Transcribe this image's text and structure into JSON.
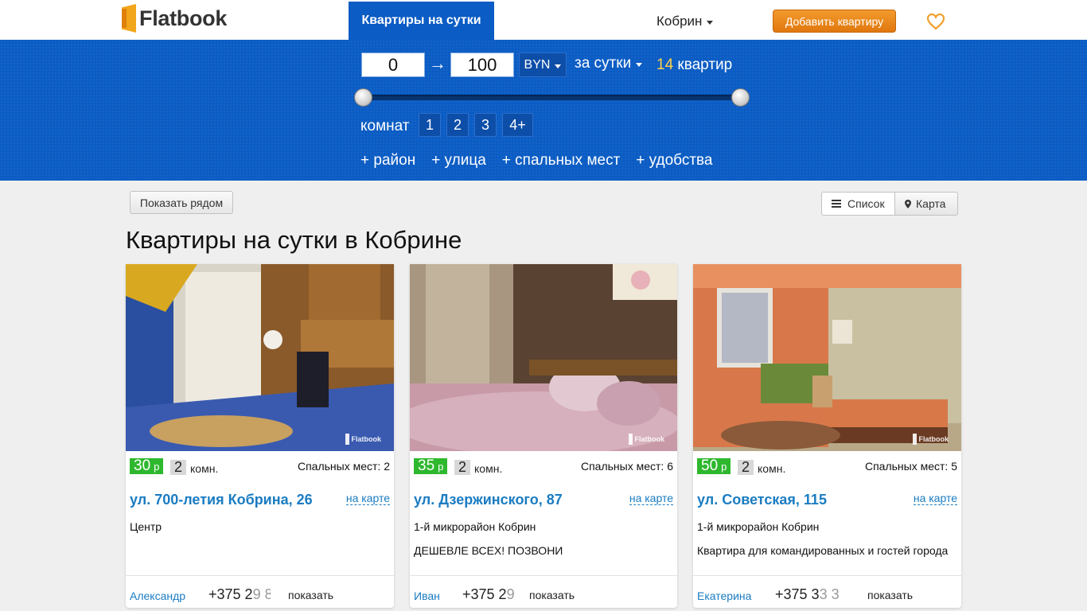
{
  "header": {
    "logo_text": "Flatbook",
    "nav_tab": "Квартиры на сутки",
    "city": "Кобрин",
    "add_button": "Добавить квартиру",
    "colors": {
      "brand_blue": "#0b5cc4",
      "accent_orange": "#e88a1f"
    }
  },
  "filters": {
    "price_min": "0",
    "arrow": "→",
    "price_max": "100",
    "currency": "BYN",
    "period": "за сутки",
    "count_number": "14",
    "count_label": "квартир",
    "rooms_label": "комнат",
    "room_options": [
      "1",
      "2",
      "3",
      "4+"
    ],
    "extras": [
      "+ район",
      "+ улица",
      "+ спальных мест",
      "+ удобства"
    ]
  },
  "controls": {
    "near_button": "Показать рядом",
    "list_button": "Список",
    "map_button": "Карта"
  },
  "page_title": "Квартиры на сутки в Кобрине",
  "listings": [
    {
      "price": "30",
      "price_unit": "р",
      "rooms": "2",
      "rooms_unit": "комн.",
      "beds": "Спальных мест: 2",
      "address": "ул. 700-летия Кобрина, 26",
      "on_map": "на карте",
      "district": "Центр",
      "description": "",
      "owner": "Александр",
      "phone_visible": "+375 2",
      "phone_faded": "9 8",
      "show_label": "показать",
      "watermark": "Flatbook"
    },
    {
      "price": "35",
      "price_unit": "р",
      "rooms": "2",
      "rooms_unit": "комн.",
      "beds": "Спальных мест: 6",
      "address": "ул. Дзержинского, 87",
      "on_map": "на карте",
      "district": "1-й микрорайон Кобрин",
      "description": "ДЕШЕВЛЕ ВСЕХ! ПОЗВОНИ",
      "owner": "Иван",
      "phone_visible": "+375 2",
      "phone_faded": "9",
      "show_label": "показать",
      "watermark": "Flatbook"
    },
    {
      "price": "50",
      "price_unit": "р",
      "rooms": "2",
      "rooms_unit": "комн.",
      "beds": "Спальных мест: 5",
      "address": "ул. Советская, 115",
      "on_map": "на карте",
      "district": "1-й микрорайон Кобрин",
      "description": "Квартира для командированных и гостей города",
      "owner": "Екатерина",
      "phone_visible": "+375 3",
      "phone_faded": "3 3",
      "show_label": "показать",
      "watermark": "Flatbook"
    }
  ]
}
